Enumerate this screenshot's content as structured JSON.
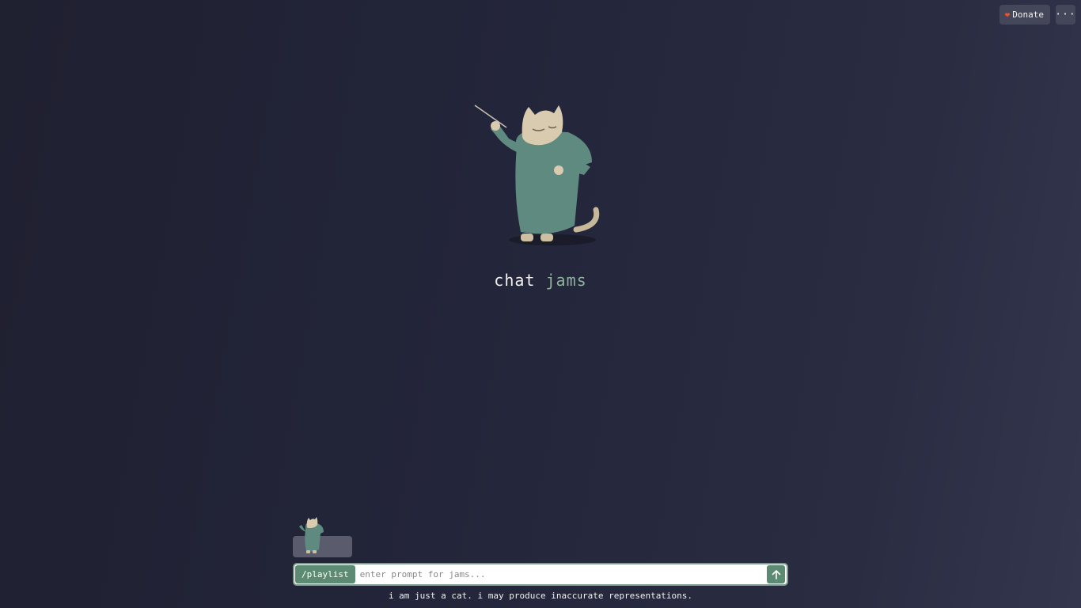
{
  "header": {
    "donate_label": "Donate",
    "donate_icon": "heart-icon",
    "more_icon": "more-horizontal-icon",
    "more_glyph": "···"
  },
  "hero": {
    "image": "cat-conductor-illustration",
    "title_word1": "chat",
    "title_word2": "jams"
  },
  "composer": {
    "command_chip": "/playlist",
    "placeholder": "enter prompt for jams...",
    "send_icon": "arrow-up-icon",
    "thumbnail": "cat-conductor-thumbnail"
  },
  "footer": {
    "disclaimer": "i am just a cat. i may produce inaccurate representations."
  },
  "colors": {
    "accent": "#5d8a72",
    "title_accent": "#8fb39d",
    "heart": "#f0502a",
    "button_bg": "#44465a"
  }
}
